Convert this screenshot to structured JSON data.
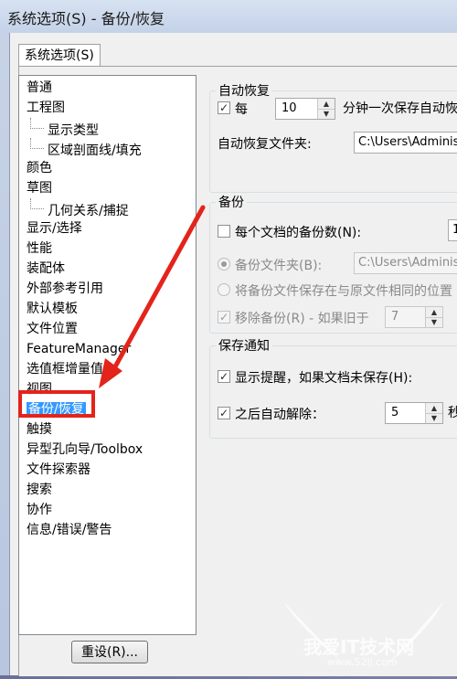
{
  "window": {
    "title": "系统选项(S) - 备份/恢复"
  },
  "tab": {
    "label": "系统选项(S)"
  },
  "tree": {
    "items": [
      "普通",
      "工程图",
      "显示类型",
      "区域剖面线/填充",
      "颜色",
      "草图",
      "几何关系/捕捉",
      "显示/选择",
      "性能",
      "装配体",
      "外部参考引用",
      "默认模板",
      "文件位置",
      "FeatureManager",
      "选值框增量值",
      "视图",
      "备份/恢复",
      "触摸",
      "异型孔向导/Toolbox",
      "文件探索器",
      "搜索",
      "协作",
      "信息/错误/警告"
    ]
  },
  "buttons": {
    "reset": "重设(R)..."
  },
  "auto_recover": {
    "title": "自动恢复",
    "every_label": "每",
    "interval": "10",
    "unit_label": "分钟一次保存自动恢",
    "folder_label": "自动恢复文件夹:",
    "folder_path": "C:\\Users\\Administr"
  },
  "backup": {
    "title": "备份",
    "count_label": "每个文档的备份数(N):",
    "count_value": "1",
    "folder_label": "备份文件夹(B):",
    "folder_path": "C:\\Users\\Administr",
    "same_location_label": "将备份文件保存在与原文件相同的位置",
    "remove_label": "移除备份(R) - 如果旧于",
    "remove_days": "7"
  },
  "save_notify": {
    "title": "保存通知",
    "show_label": "显示提醒，如果文档未保存(H):",
    "dismiss_label": "之后自动解除：",
    "dismiss_value": "5",
    "dismiss_unit": "秒"
  },
  "watermark": {
    "text": "我爱IT技术网",
    "url": "www.52ij.com"
  },
  "colors": {
    "highlight": "#3399ff",
    "annotation_red": "#e3241b"
  }
}
